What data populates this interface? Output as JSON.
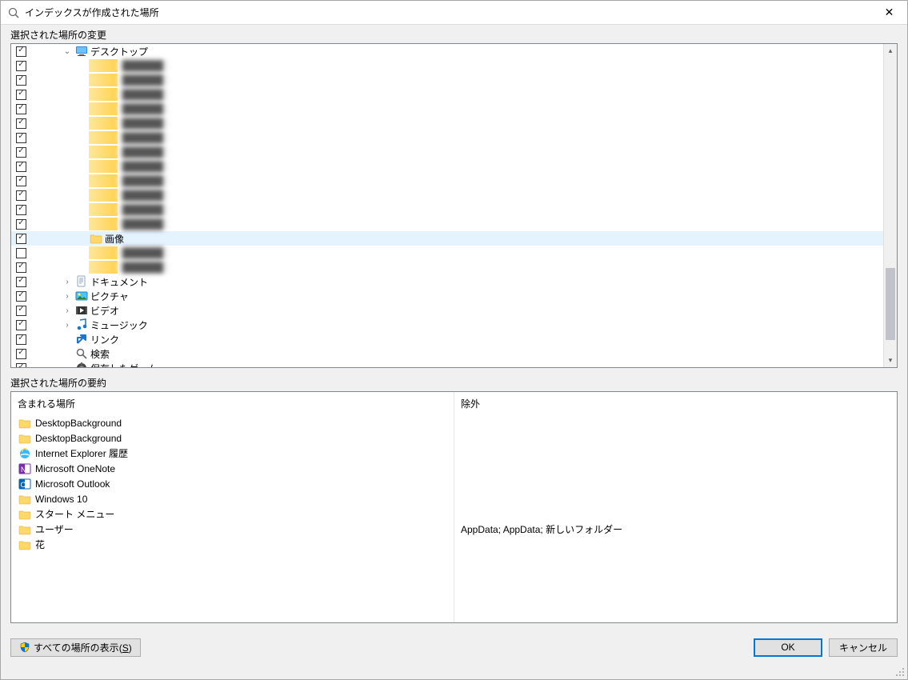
{
  "window": {
    "title": "インデックスが作成された場所"
  },
  "groups": {
    "change_label": "選択された場所の変更",
    "summary_label": "選択された場所の要約"
  },
  "tree": {
    "root_label": "デスクトップ",
    "selected_label": "画像",
    "items": [
      {
        "checked": true,
        "indent": 1,
        "expander": "down",
        "icon": "desktop",
        "label_key": "tree.root_label"
      },
      {
        "checked": true,
        "indent": 2,
        "blur": true
      },
      {
        "checked": true,
        "indent": 2,
        "blur": true
      },
      {
        "checked": true,
        "indent": 2,
        "blur": true
      },
      {
        "checked": true,
        "indent": 2,
        "blur": true
      },
      {
        "checked": true,
        "indent": 2,
        "blur": true
      },
      {
        "checked": true,
        "indent": 2,
        "blur": true
      },
      {
        "checked": true,
        "indent": 2,
        "blur": true
      },
      {
        "checked": true,
        "indent": 2,
        "blur": true
      },
      {
        "checked": true,
        "indent": 2,
        "blur": true
      },
      {
        "checked": true,
        "indent": 2,
        "blur": true
      },
      {
        "checked": true,
        "indent": 2,
        "blur": true
      },
      {
        "checked": true,
        "indent": 2,
        "blur": true
      },
      {
        "checked": true,
        "indent": 2,
        "icon": "folder",
        "label_key": "tree.selected_label",
        "selected": true
      },
      {
        "checked": false,
        "indent": 2,
        "blur": true
      },
      {
        "checked": true,
        "indent": 2,
        "blur": true
      },
      {
        "checked": true,
        "indent": 1,
        "expander": "right",
        "icon": "document",
        "label_key": "tree.named.documents"
      },
      {
        "checked": true,
        "indent": 1,
        "expander": "right",
        "icon": "pictures",
        "label_key": "tree.named.pictures"
      },
      {
        "checked": true,
        "indent": 1,
        "expander": "right",
        "icon": "video",
        "label_key": "tree.named.video"
      },
      {
        "checked": true,
        "indent": 1,
        "expander": "right",
        "icon": "music",
        "label_key": "tree.named.music"
      },
      {
        "checked": true,
        "indent": 1,
        "expander": "",
        "icon": "link",
        "label_key": "tree.named.links"
      },
      {
        "checked": true,
        "indent": 1,
        "expander": "",
        "icon": "search",
        "label_key": "tree.named.search"
      },
      {
        "checked": true,
        "indent": 1,
        "expander": "",
        "icon": "saved",
        "label_key": "tree.named.savedgame"
      }
    ],
    "named": {
      "documents": "ドキュメント",
      "pictures": "ピクチャ",
      "video": "ビデオ",
      "music": "ミュージック",
      "links": "リンク",
      "search": "検索",
      "savedgame": "保存したゲーム"
    }
  },
  "summary": {
    "include_header": "含まれる場所",
    "exclude_header": "除外",
    "include": [
      {
        "icon": "folder",
        "label": "DesktopBackground"
      },
      {
        "icon": "folder",
        "label": "DesktopBackground"
      },
      {
        "icon": "ie",
        "label": "Internet Explorer 履歴"
      },
      {
        "icon": "onenote",
        "label": "Microsoft OneNote"
      },
      {
        "icon": "outlook",
        "label": "Microsoft Outlook"
      },
      {
        "icon": "folder",
        "label": "Windows 10"
      },
      {
        "icon": "folder",
        "label": "スタート メニュー"
      },
      {
        "icon": "folder",
        "label": "ユーザー"
      },
      {
        "icon": "folder",
        "label": "花"
      }
    ],
    "exclude": [
      "",
      "",
      "",
      "",
      "",
      "",
      "",
      "AppData; AppData; 新しいフォルダー",
      ""
    ]
  },
  "buttons": {
    "show_all": "すべての場所の表示",
    "show_all_key": "S",
    "ok": "OK",
    "cancel": "キャンセル"
  }
}
